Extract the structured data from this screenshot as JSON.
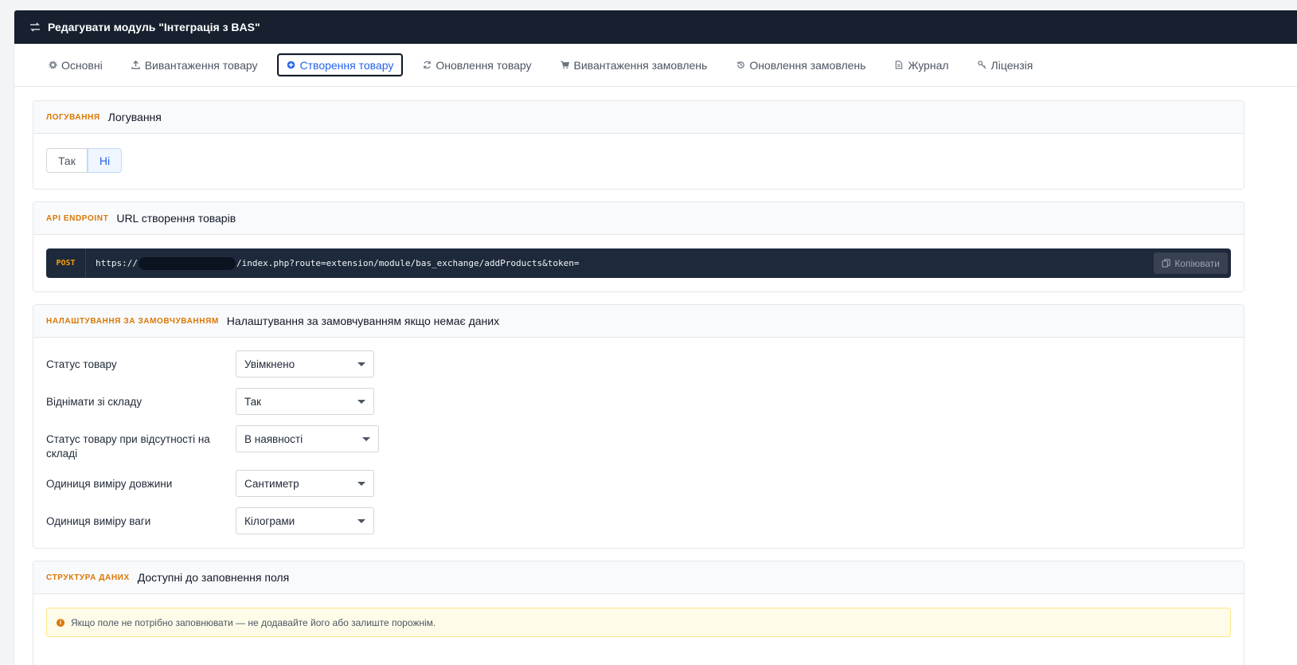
{
  "header": {
    "title": "Редагувати модуль \"Інтеграція з BAS\"",
    "icon": "exchange-arrows-icon"
  },
  "tabs": [
    {
      "label": "Основні",
      "icon": "gear-icon",
      "active": false
    },
    {
      "label": "Вивантаження товару",
      "icon": "upload-icon",
      "active": false
    },
    {
      "label": "Створення товару",
      "icon": "plus-circle-icon",
      "active": true
    },
    {
      "label": "Оновлення товару",
      "icon": "refresh-icon",
      "active": false
    },
    {
      "label": "Вивантаження замовлень",
      "icon": "cart-icon",
      "active": false
    },
    {
      "label": "Оновлення замовлень",
      "icon": "history-icon",
      "active": false
    },
    {
      "label": "Журнал",
      "icon": "document-icon",
      "active": false
    },
    {
      "label": "Ліцензія",
      "icon": "key-icon",
      "active": false
    }
  ],
  "logging": {
    "kicker": "ЛОГУВАННЯ",
    "title": "Логування",
    "options": [
      "Так",
      "Ні"
    ],
    "selected": "Ні"
  },
  "endpoint": {
    "kicker": "API ENDPOINT",
    "title": "URL створення товарів",
    "method": "POST",
    "url_prefix": "https://",
    "url_suffix": "/index.php?route=extension/module/bas_exchange/addProducts&token=",
    "copy_label": "Копіювати"
  },
  "defaults": {
    "kicker": "НАЛАШТУВАННЯ ЗА ЗАМОВЧУВАННЯМ",
    "title": "Налаштування за замовчуванням якщо немає даних",
    "fields": [
      {
        "label": "Статус товару",
        "value": "Увімкнено"
      },
      {
        "label": "Віднімати зі складу",
        "value": "Так"
      },
      {
        "label": "Статус товару при відсутності на складі",
        "value": "В наявності"
      },
      {
        "label": "Одиниця виміру довжини",
        "value": "Сантиметр"
      },
      {
        "label": "Одиниця виміру ваги",
        "value": "Кілограми"
      }
    ]
  },
  "structure": {
    "kicker": "СТРУКТУРА ДАНИХ",
    "title": "Доступні до заповнення поля",
    "alert": "Якщо поле не потрібно заповнювати — не додавайте його або залиште порожнім."
  },
  "colors": {
    "topbar": "#16202e",
    "accent": "#d97706",
    "active_tab": "#2563eb"
  }
}
